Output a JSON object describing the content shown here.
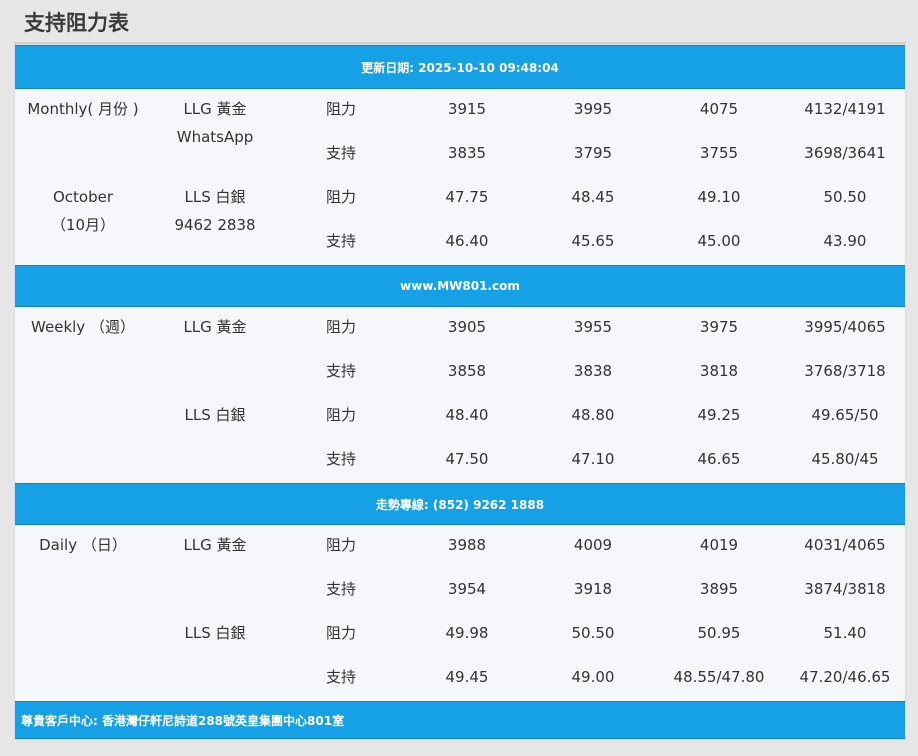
{
  "page_title": "支持阻力表",
  "updated_label": "更新日期: 2025-10-10 09:48:04",
  "website_bar": "www.MW801.com",
  "hotline_bar": "走勢專線: (852) 9262 1888",
  "address_bar": "尊貴客戶中心: 香港灣仔軒尼詩道288號英皇集團中心801室",
  "monthly": {
    "period_line1": "Monthly( 月份 )",
    "period_line2": "October",
    "period_line3": "（10月）",
    "gold_label": "LLG 黃金",
    "gold_sub": "WhatsApp",
    "silver_label": "LLS 白銀",
    "silver_sub": "9462 2838",
    "rows": [
      {
        "kind": "阻力",
        "v": [
          "3915",
          "3995",
          "4075",
          "4132/4191"
        ]
      },
      {
        "kind": "支持",
        "v": [
          "3835",
          "3795",
          "3755",
          "3698/3641"
        ]
      },
      {
        "kind": "阻力",
        "v": [
          "47.75",
          "48.45",
          "49.10",
          "50.50"
        ]
      },
      {
        "kind": "支持",
        "v": [
          "46.40",
          "45.65",
          "45.00",
          "43.90"
        ]
      }
    ]
  },
  "weekly": {
    "period": "Weekly （週）",
    "gold_label": "LLG 黃金",
    "silver_label": "LLS 白銀",
    "rows": [
      {
        "kind": "阻力",
        "v": [
          "3905",
          "3955",
          "3975",
          "3995/4065"
        ]
      },
      {
        "kind": "支持",
        "v": [
          "3858",
          "3838",
          "3818",
          "3768/3718"
        ]
      },
      {
        "kind": "阻力",
        "v": [
          "48.40",
          "48.80",
          "49.25",
          "49.65/50"
        ]
      },
      {
        "kind": "支持",
        "v": [
          "47.50",
          "47.10",
          "46.65",
          "45.80/45"
        ]
      }
    ]
  },
  "daily": {
    "period": "Daily （日）",
    "gold_label": "LLG 黃金",
    "silver_label": "LLS 白銀",
    "rows": [
      {
        "kind": "阻力",
        "v": [
          "3988",
          "4009",
          "4019",
          "4031/4065"
        ]
      },
      {
        "kind": "支持",
        "v": [
          "3954",
          "3918",
          "3895",
          "3874/3818"
        ]
      },
      {
        "kind": "阻力",
        "v": [
          "49.98",
          "50.50",
          "50.95",
          "51.40"
        ]
      },
      {
        "kind": "支持",
        "v": [
          "49.45",
          "49.00",
          "48.55/47.80",
          "47.20/46.65"
        ]
      }
    ]
  }
}
